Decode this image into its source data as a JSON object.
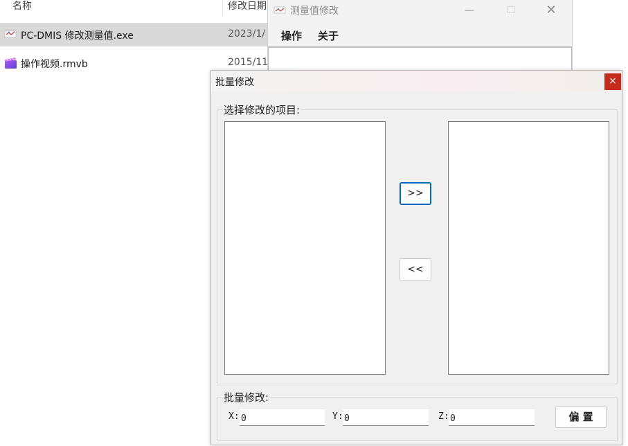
{
  "explorer": {
    "columns": {
      "name": "名称",
      "modified": "修改日期"
    },
    "files": [
      {
        "name": "PC-DMIS 修改测量值.exe",
        "date": "2023/1/",
        "icon": "app-exe-icon"
      },
      {
        "name": "操作视频.rmvb",
        "date": "2015/11",
        "icon": "video-file-icon"
      }
    ]
  },
  "main_window": {
    "title": "测量值修改",
    "controls": {
      "minimize": "—",
      "maximize": "☐",
      "close": "✕"
    },
    "menu": {
      "operate": "操作",
      "about": "关于"
    }
  },
  "dialog": {
    "title": "批量修改",
    "close_glyph": "×",
    "select_group_label": "选择修改的项目:",
    "add_button": ">>",
    "remove_button": "<<",
    "batch_group_label": "批量修改:",
    "x_label": "X:",
    "y_label": "Y:",
    "z_label": "Z:",
    "x_value": "0",
    "y_value": "0",
    "z_value": "0",
    "offset_button": "偏 置"
  },
  "colors": {
    "close_red": "#c42b1c",
    "selection_gray": "#d9d9d9",
    "default_button_blue": "#0067c0"
  }
}
